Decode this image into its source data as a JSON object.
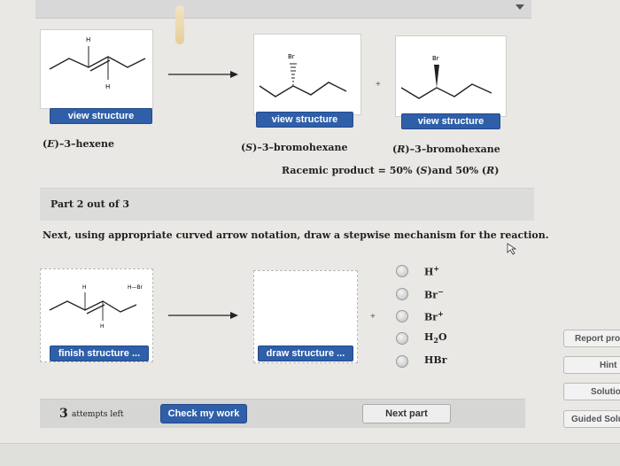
{
  "part1": {
    "reactant": {
      "atoms": {
        "h_top": "H",
        "h_bottom": "H"
      },
      "button": "view structure",
      "name_left": "(",
      "name_e": "E",
      "name_rest": ")–3–hexene"
    },
    "product_s": {
      "atom": "Br",
      "button": "view structure",
      "name_left": "(",
      "name_stereo": "S",
      "name_rest": ")–3–bromohexane"
    },
    "product_r": {
      "atom": "Br",
      "button": "view structure",
      "name_left": "(",
      "name_stereo": "R",
      "name_rest": ")–3–bromohexane"
    },
    "plus": "+",
    "racemic": {
      "prefix": "Racemic product = 50% (",
      "s": "S",
      "middle": ")and 50% (",
      "r": "R",
      "suffix": ")"
    }
  },
  "part_header": "Part 2 out of 3",
  "instructions": "Next, using appropriate curved arrow notation, draw a stepwise mechanism for the reaction.",
  "mechanism": {
    "start_atoms": {
      "h_top": "H",
      "h_bottom": "H",
      "hbr": "H—Br"
    },
    "finish_button": "finish structure ...",
    "draw_button": "draw structure ...",
    "plus": "+"
  },
  "reagents": [
    {
      "base": "H",
      "sup": "+",
      "sub": ""
    },
    {
      "base": "Br",
      "sup": "−",
      "sub": ""
    },
    {
      "base": "Br",
      "sup": "+",
      "sub": ""
    },
    {
      "base": "H",
      "sup": "",
      "sub": "2",
      "tail": "O"
    },
    {
      "base": "HBr",
      "sup": "",
      "sub": ""
    }
  ],
  "side": {
    "report": "Report pro",
    "hint": "Hint",
    "solution": "Solution",
    "guided": "Guided Solu"
  },
  "footer": {
    "attempts_num": "3",
    "attempts_text": "attempts left",
    "check": "Check my work",
    "next": "Next part"
  },
  "colors": {
    "button_blue": "#2f5fa8",
    "bond": "#222222"
  }
}
